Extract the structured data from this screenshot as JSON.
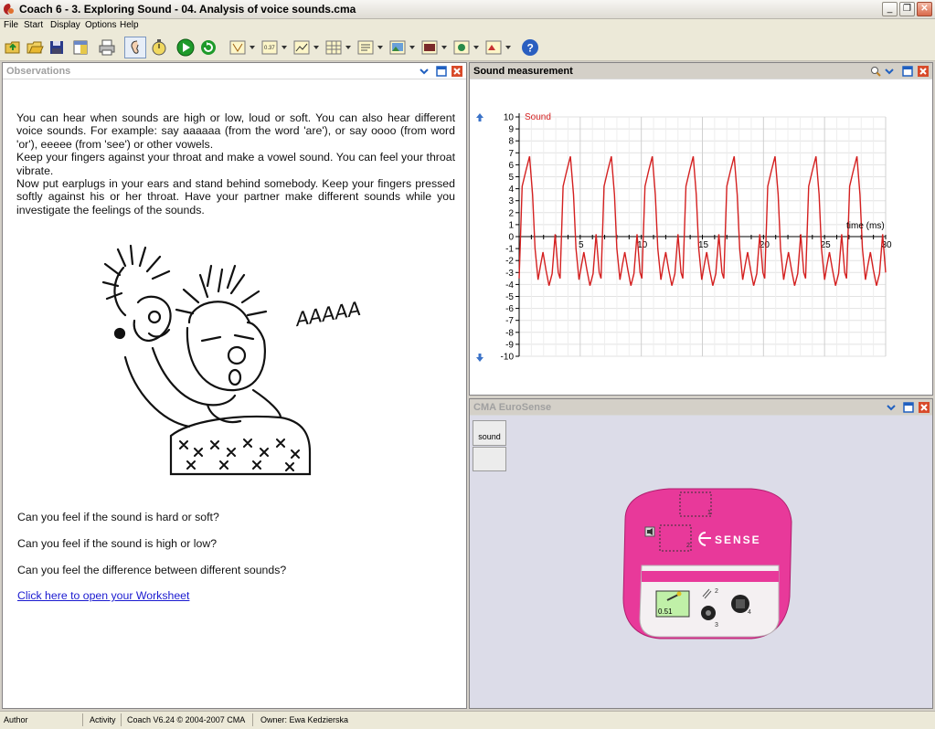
{
  "window": {
    "title": "Coach 6 - 3. Exploring Sound - 04. Analysis of voice sounds.cma",
    "minimize": "_",
    "restore": "❐",
    "close": "✕"
  },
  "menu": [
    "File",
    "Start",
    "Display",
    "Options",
    "Help"
  ],
  "toolbar": {
    "icons": [
      "open-activity-icon",
      "open-folder-icon",
      "save-icon",
      "new-window-icon",
      "print-icon",
      "ear-tool-icon",
      "stopwatch-icon",
      "start-measurement-icon",
      "replay-icon",
      "diagram-icon",
      "meter-icon",
      "graph-icon",
      "table-icon",
      "text-icon",
      "picture-icon",
      "video-icon",
      "model-icon",
      "label-icon",
      "help-icon"
    ],
    "colors": {
      "green": "#1e9a2a",
      "help_blue": "#2a5fc0"
    }
  },
  "observations": {
    "title": "Observations",
    "paragraphs": [
      "You can hear when sounds are high or low, loud or soft. You can also hear different voice sounds. For example:  say aaaaaa (from the word 'are'), or say oooo (from word 'or'), eeeee (from 'see') or other vowels.",
      "Keep your fingers against your throat and make a vowel sound. You can feel your throat vibrate.",
      "Now put earplugs in your ears and stand behind somebody. Keep your fingers pressed softly against his or her throat. Have your partner make different sounds while you investigate the feelings of the sounds."
    ],
    "drawing_caption": "AAAAA",
    "questions": [
      "Can you feel if the sound is hard or soft?",
      "Can you feel if the sound is high or low?",
      "Can you feel the difference between different sounds?"
    ],
    "link": "Click here to open your Worksheet"
  },
  "sound_panel": {
    "title": "Sound measurement"
  },
  "chart_data": {
    "type": "line",
    "series": [
      {
        "name": "Sound",
        "color": "#d42020"
      }
    ],
    "xlabel": "time (ms)",
    "ylabel": "",
    "xlim": [
      0,
      30
    ],
    "ylim": [
      -10,
      10
    ],
    "xticks": [
      5,
      10,
      15,
      20,
      25,
      30
    ],
    "yticks": [
      10,
      9,
      8,
      7,
      6,
      5,
      4,
      3,
      2,
      1,
      0,
      -1,
      -2,
      -3,
      -4,
      -5,
      -6,
      -7,
      -8,
      -9,
      -10
    ],
    "grid": true,
    "period_ms": 3.35,
    "waveform_cycle": [
      [
        0,
        -3.5
      ],
      [
        0.25,
        4.2
      ],
      [
        0.55,
        5.5
      ],
      [
        0.85,
        6.7
      ],
      [
        1.1,
        3.5
      ],
      [
        1.3,
        -1.0
      ],
      [
        1.55,
        -3.6
      ],
      [
        1.75,
        -2.4
      ],
      [
        1.95,
        -1.3
      ],
      [
        2.2,
        -2.8
      ],
      [
        2.45,
        -4.1
      ],
      [
        2.7,
        -3.1
      ],
      [
        2.95,
        0.2
      ],
      [
        3.2,
        -3.0
      ],
      [
        3.35,
        -3.5
      ]
    ]
  },
  "eurosense": {
    "title": "CMA EuroSense",
    "sensor_label": "sound",
    "brand": "SENSE",
    "reading": "0.51",
    "ports": [
      "1",
      "2",
      "2",
      "3",
      "4"
    ],
    "device_color": "#e8399a"
  },
  "status": {
    "author": "Author",
    "activity": "Activity",
    "version": "Coach V6.24 © 2004-2007 CMA",
    "owner": "Owner: Ewa Kedzierska"
  }
}
